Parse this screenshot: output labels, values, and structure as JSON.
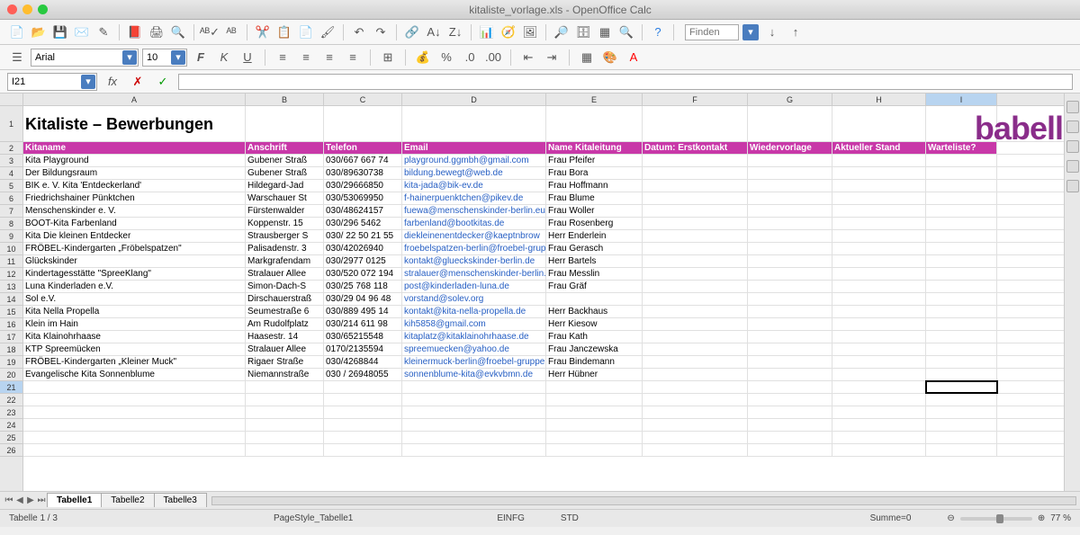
{
  "window": {
    "title": "kitaliste_vorlage.xls - OpenOffice Calc"
  },
  "find": {
    "label": "Finden"
  },
  "font": {
    "name": "Arial",
    "size": "10"
  },
  "cellref": "I21",
  "columns": [
    "A",
    "B",
    "C",
    "D",
    "E",
    "F",
    "G",
    "H",
    "I"
  ],
  "title_cell": "Kitaliste – Bewerbungen",
  "logo": "babelli",
  "headers": [
    "Kitaname",
    "Anschrift",
    "Telefon",
    "Email",
    "Name Kitaleitung",
    "Datum: Erstkontakt",
    "Wiedervorlage",
    "Aktueller Stand",
    "Warteliste?"
  ],
  "rows": [
    {
      "n": 3,
      "a": "Kita Playground",
      "b": "Gubener Straß",
      "c": "030/667 667 74",
      "d": "playground.ggmbh@gmail.com",
      "e": "Frau Pfeifer"
    },
    {
      "n": 4,
      "a": "Der Bildungsraum",
      "b": "Gubener Straß",
      "c": "030/89630738",
      "d": "bildung.bewegt@web.de",
      "e": "Frau Bora"
    },
    {
      "n": 5,
      "a": "BIK e. V. Kita 'Entdeckerland'",
      "b": "Hildegard-Jad",
      "c": "030/29666850",
      "d": "kita-jada@bik-ev.de",
      "e": "Frau Hoffmann"
    },
    {
      "n": 6,
      "a": "Friedrichshainer Pünktchen",
      "b": "Warschauer St",
      "c": "030/53069950",
      "d": "f-hainerpuenktchen@pikev.de",
      "e": "Frau Blume"
    },
    {
      "n": 7,
      "a": "Menschenskinder e. V.",
      "b": "Fürstenwalder",
      "c": "030/48624157",
      "d": "fuewa@menschenskinder-berlin.eu",
      "e": "Frau Woller"
    },
    {
      "n": 8,
      "a": "BOOT-Kita Farbenland",
      "b": "Koppenstr. 15",
      "c": "030/296 5462",
      "d": "farbenland@bootkitas.de",
      "e": "Frau Rosenberg"
    },
    {
      "n": 9,
      "a": "Kita Die kleinen Entdecker",
      "b": "Strausberger S",
      "c": "030/ 22 50 21 55",
      "d": "diekleinenentdecker@kaeptnbrow",
      "e": "Herr Enderlein"
    },
    {
      "n": 10,
      "a": "FRÖBEL-Kindergarten „Fröbelspatzen\"",
      "b": "Palisadenstr. 3",
      "c": "030/42026940",
      "d": "froebelspatzen-berlin@froebel-grupp",
      "e": "Frau Gerasch"
    },
    {
      "n": 11,
      "a": "Glückskinder",
      "b": "Markgrafendam",
      "c": "030/2977 0125",
      "d": "kontakt@glueckskinder-berlin.de",
      "e": "Herr Bartels"
    },
    {
      "n": 12,
      "a": "Kindertagesstätte \"SpreeKlang\"",
      "b": "Stralauer Allee",
      "c": "030/520 072 194",
      "d": "stralauer@menschenskinder-berlin.eu",
      "e": "Frau Messlin"
    },
    {
      "n": 13,
      "a": "Luna Kinderladen e.V.",
      "b": "Simon-Dach-S",
      "c": "030/25 768 118",
      "d": "post@kinderladen-luna.de",
      "e": "Frau Gräf"
    },
    {
      "n": 14,
      "a": "Sol e.V.",
      "b": "Dirschauerstraß",
      "c": "030/29 04 96 48",
      "d": "vorstand@solev.org",
      "e": ""
    },
    {
      "n": 15,
      "a": "Kita Nella Propella",
      "b": "Seumestraße 6",
      "c": "030/889 495 14",
      "d": "kontakt@kita-nella-propella.de",
      "e": "Herr Backhaus"
    },
    {
      "n": 16,
      "a": "Klein im Hain",
      "b": "Am Rudolfplatz",
      "c": "030/214 611 98",
      "d": "kih5858@gmail.com",
      "e": "Herr Kiesow"
    },
    {
      "n": 17,
      "a": "Kita Klainohrhaase",
      "b": "Haasestr. 14",
      "c": "030/65215548",
      "d": "kitaplatz@kitaklainohrhaase.de",
      "e": "Frau Kath"
    },
    {
      "n": 18,
      "a": "KTP Spreemücken",
      "b": "Stralauer Allee",
      "c": "0170/2135594",
      "d": "spreemuecken@yahoo.de",
      "e": "Frau Janczewska"
    },
    {
      "n": 19,
      "a": "FRÖBEL-Kindergarten „Kleiner Muck\"",
      "b": "Rigaer Straße",
      "c": "030/4268844",
      "d": "kleinermuck-berlin@froebel-gruppe.d",
      "e": "Frau Bindemann"
    },
    {
      "n": 20,
      "a": "Evangelische Kita Sonnenblume",
      "b": "Niemannstraße",
      "c": "030 / 26948055",
      "d": "sonnenblume-kita@evkvbmn.de",
      "e": "Herr Hübner"
    }
  ],
  "empty_rows": [
    21,
    22,
    23,
    24,
    25,
    26
  ],
  "selected_row": 21,
  "tabs": [
    "Tabelle1",
    "Tabelle2",
    "Tabelle3"
  ],
  "active_tab": 0,
  "status": {
    "sheet": "Tabelle 1 / 3",
    "pagestyle": "PageStyle_Tabelle1",
    "insert": "EINFG",
    "std": "STD",
    "sum": "Summe=0",
    "zoom": "77 %"
  }
}
